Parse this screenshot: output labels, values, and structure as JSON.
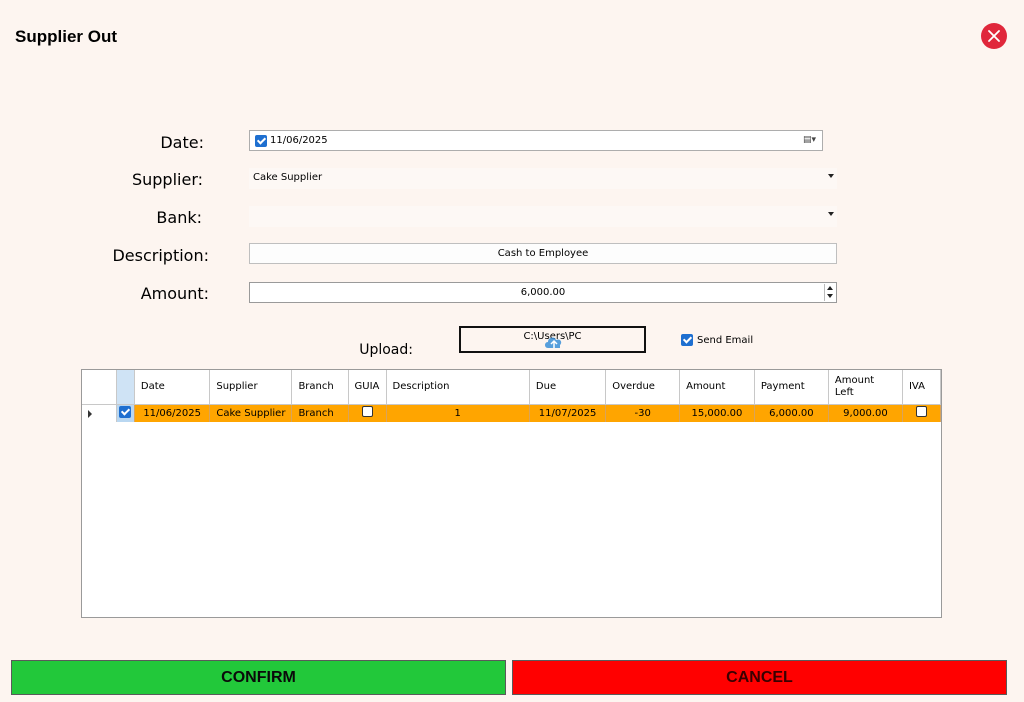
{
  "window": {
    "title": "Supplier Out"
  },
  "form": {
    "date_label": "Date:",
    "date_value": "11/06/2025",
    "supplier_label": "Supplier:",
    "supplier_value": "Cake Supplier",
    "bank_label": "Bank:",
    "bank_value": "",
    "description_label": "Description:",
    "description_value": "Cash to Employee",
    "amount_label": "Amount:",
    "amount_value": "6,000.00",
    "upload_label": "Upload:",
    "upload_path": "C:\\Users\\PC",
    "send_email_label": "Send Email",
    "send_email_checked": true
  },
  "grid": {
    "columns": [
      "Date",
      "Supplier",
      "Branch",
      "GUIA",
      "Description",
      "Due",
      "Overdue",
      "Amount",
      "Payment",
      "Amount Left",
      "IVA"
    ],
    "rows": [
      {
        "selected": true,
        "date": "11/06/2025",
        "supplier": "Cake Supplier",
        "branch": "Branch",
        "guia": false,
        "description": "1",
        "due": "11/07/2025",
        "overdue": "-30",
        "amount": "15,000.00",
        "payment": "6,000.00",
        "amount_left": "9,000.00",
        "iva": false
      }
    ]
  },
  "buttons": {
    "confirm": "CONFIRM",
    "cancel": "CANCEL"
  },
  "colors": {
    "confirm": "#22c83a",
    "cancel": "#ff0000",
    "selected_row": "#ffa500",
    "close": "#e0273b"
  }
}
